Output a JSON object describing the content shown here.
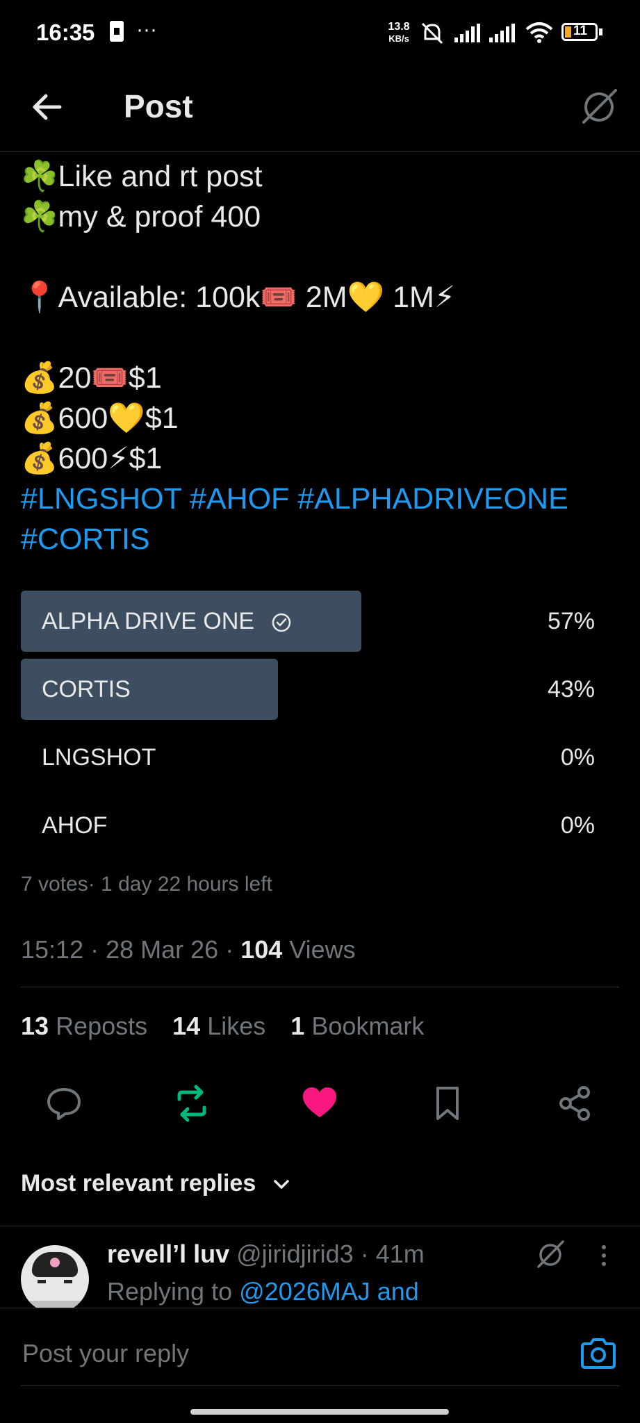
{
  "status_bar": {
    "time": "16:35",
    "net_speed_value": "13.8",
    "net_speed_unit": "KB/s",
    "battery": "11"
  },
  "header": {
    "title": "Post"
  },
  "post": {
    "lines": [
      {
        "emoji": "☘️",
        "text": "Like and rt post"
      },
      {
        "emoji": "☘️",
        "text": "my & proof 400"
      },
      {
        "emoji": "📍",
        "text": "Available: 100k🎟️ 2M💛 1M⚡"
      },
      {
        "emoji": "💰",
        "text": "20🎟️$1"
      },
      {
        "emoji": "💰",
        "text": "600💛$1"
      },
      {
        "emoji": "💰",
        "text": "600⚡$1"
      }
    ],
    "hashtags_line1": "#LNGSHOT #AHOF #ALPHADRIVEONE",
    "hashtags_line2": "#CORTIS"
  },
  "poll": {
    "options": [
      {
        "label": "ALPHA DRIVE ONE",
        "percent": "57%",
        "fraction": 0.57,
        "selected": true
      },
      {
        "label": "CORTIS",
        "percent": "43%",
        "fraction": 0.43,
        "selected": false
      },
      {
        "label": "LNGSHOT",
        "percent": "0%",
        "fraction": 0,
        "selected": false
      },
      {
        "label": "AHOF",
        "percent": "0%",
        "fraction": 0,
        "selected": false
      }
    ],
    "meta": "7 votes· 1 day 22 hours left"
  },
  "timestamp": {
    "time": "15:12",
    "date": "28 Mar 26",
    "views_count": "104",
    "views_label": "Views"
  },
  "stats": {
    "reposts_count": "13",
    "reposts_label": "Reposts",
    "likes_count": "14",
    "likes_label": "Likes",
    "bookmarks_count": "1",
    "bookmarks_label": "Bookmark"
  },
  "actions": {
    "reply": "reply-icon",
    "repost": "repost-icon",
    "like": "heart-icon",
    "bookmark": "bookmark-icon",
    "share": "share-icon",
    "repost_color": "#00ba7c",
    "like_color": "#f91880"
  },
  "replies": {
    "sort_label": "Most relevant replies",
    "first": {
      "name": "revell’l luv",
      "handle": "@jiridjirid3",
      "time": "41m",
      "replying_prefix": "Replying to",
      "replying_to": "@2026MAJ and"
    }
  },
  "composer": {
    "placeholder": "Post your reply"
  },
  "colors": {
    "link": "#1d9bf0",
    "muted": "#71767b",
    "poll_fill": "#3c4e5f",
    "background": "#000000"
  }
}
